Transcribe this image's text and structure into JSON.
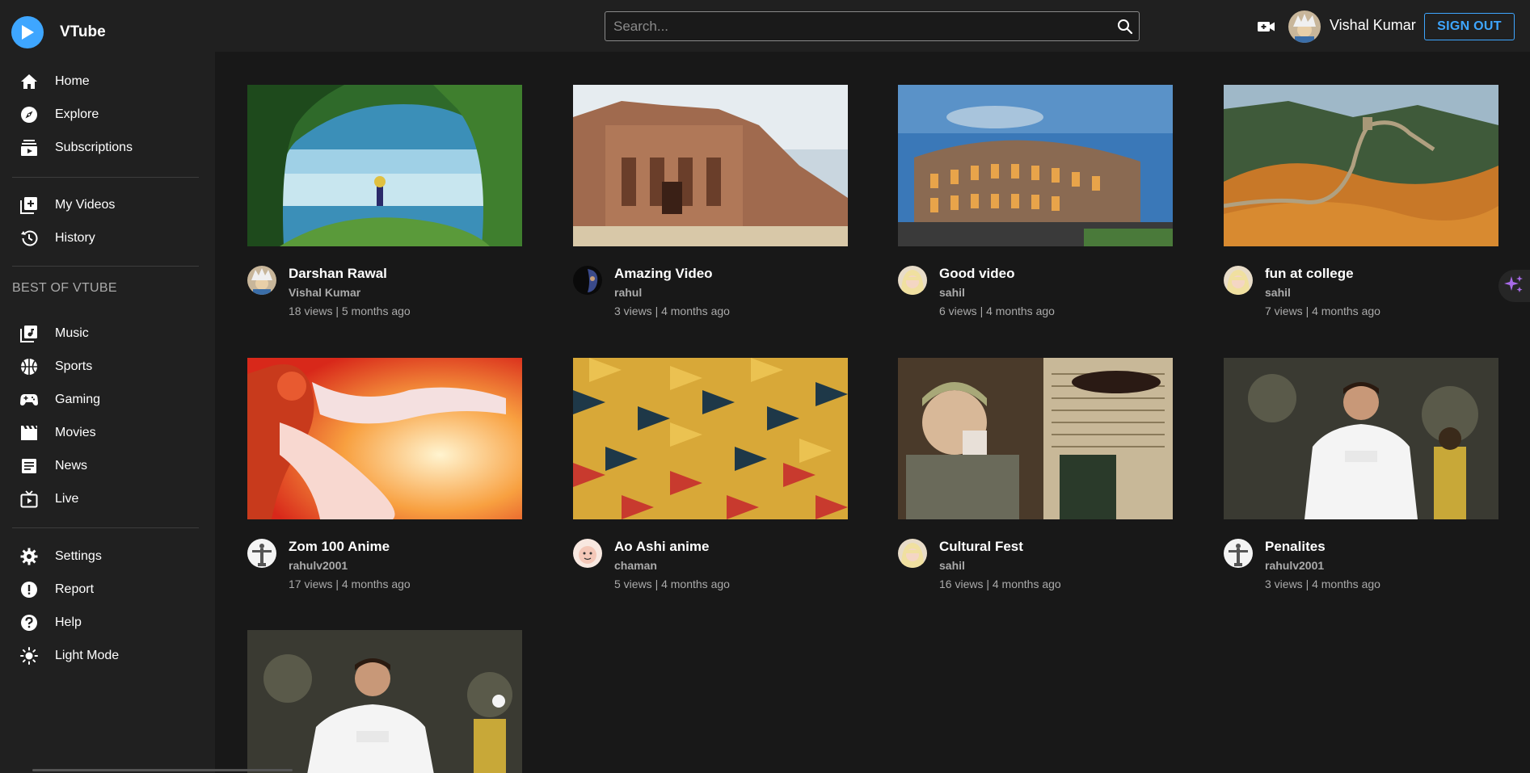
{
  "app": {
    "title": "VTube"
  },
  "header": {
    "search_placeholder": "Search...",
    "upload_icon": "video-plus-icon",
    "username": "Vishal Kumar",
    "signout_label": "SIGN OUT"
  },
  "sidebar": {
    "group1": [
      {
        "label": "Home",
        "icon": "home-icon"
      },
      {
        "label": "Explore",
        "icon": "compass-icon"
      },
      {
        "label": "Subscriptions",
        "icon": "subscriptions-icon"
      }
    ],
    "group2": [
      {
        "label": "My Videos",
        "icon": "add-video-icon"
      },
      {
        "label": "History",
        "icon": "history-icon"
      }
    ],
    "section_title": "BEST OF VTUBE",
    "group3": [
      {
        "label": "Music",
        "icon": "music-library-icon"
      },
      {
        "label": "Sports",
        "icon": "sports-basketball-icon"
      },
      {
        "label": "Gaming",
        "icon": "gamepad-icon"
      },
      {
        "label": "Movies",
        "icon": "movie-clapper-icon"
      },
      {
        "label": "News",
        "icon": "article-icon"
      },
      {
        "label": "Live",
        "icon": "live-tv-icon"
      }
    ],
    "group4": [
      {
        "label": "Settings",
        "icon": "settings-gear-icon"
      },
      {
        "label": "Report",
        "icon": "report-icon"
      },
      {
        "label": "Help",
        "icon": "help-icon"
      },
      {
        "label": "Light Mode",
        "icon": "sun-icon"
      }
    ]
  },
  "videos": [
    {
      "title": "Darshan Rawal",
      "channel": "Vishal Kumar",
      "meta": "18 views | 5 months ago"
    },
    {
      "title": "Amazing Video",
      "channel": "rahul",
      "meta": "3 views | 4 months ago"
    },
    {
      "title": "Good video",
      "channel": "sahil",
      "meta": "6 views | 4 months ago"
    },
    {
      "title": "fun at college",
      "channel": "sahil",
      "meta": "7 views | 4 months ago"
    },
    {
      "title": "Zom 100 Anime",
      "channel": "rahulv2001",
      "meta": "17 views | 4 months ago"
    },
    {
      "title": "Ao Ashi anime",
      "channel": "chaman",
      "meta": "5 views | 4 months ago"
    },
    {
      "title": "Cultural Fest",
      "channel": "sahil",
      "meta": "16 views | 4 months ago"
    },
    {
      "title": "Penalites",
      "channel": "rahulv2001",
      "meta": "3 views | 4 months ago"
    },
    {
      "title": "",
      "channel": "",
      "meta": ""
    }
  ],
  "colors": {
    "accent": "#3ea6ff",
    "background": "#181818",
    "panel": "#202020",
    "secondary_text": "#aaaaaa"
  },
  "assistant_fab_icon": "sparkle-icon"
}
